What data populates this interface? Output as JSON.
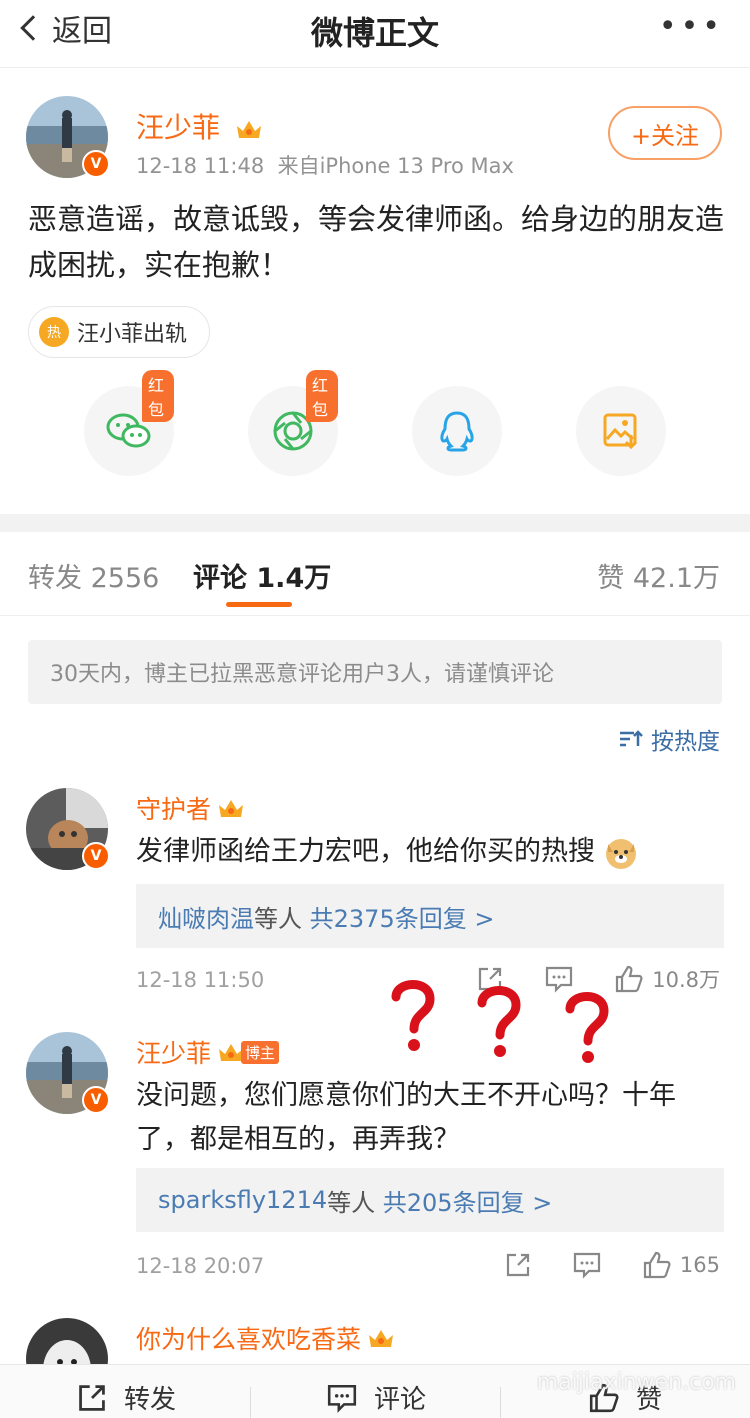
{
  "nav": {
    "back_label": "返回",
    "title": "微博正文",
    "more": "•••"
  },
  "post": {
    "author": "汪少菲",
    "verified_badge": "V",
    "time": "12-18 11:48",
    "source": "来自iPhone 13 Pro Max",
    "follow_label": "+关注",
    "text": "恶意造谣，故意诋毁，等会发律师函。给身边的朋友造成困扰，实在抱歉！",
    "topic_badge": "热",
    "topic": "汪小菲出轨",
    "share": {
      "hongbao_tag": "红包",
      "items": [
        "wechat-icon",
        "moments-icon",
        "qq-icon",
        "save-image-icon"
      ]
    }
  },
  "tabs": {
    "repost": "转发 2556",
    "comments": "评论 1.4万",
    "likes": "赞 42.1万"
  },
  "notice": "30天内，博主已拉黑恶意评论用户3人，请谨慎评论",
  "sort_label": "按热度",
  "comments": [
    {
      "name": "守护者",
      "verified_badge": "V",
      "text": "发律师函给王力宏吧，他给你买的热搜",
      "emoji": "doge-emoji",
      "reply_users": "灿啵肉温",
      "reply_mid": "等人",
      "reply_count": "共2375条回复 >",
      "time": "12-18 11:50",
      "likes": "10.8万"
    },
    {
      "name": "汪少菲",
      "verified_badge": "V",
      "host_tag": "博主",
      "text": "没问题，您们愿意你们的大王不开心吗？十年了，都是相互的，再弄我？",
      "reply_users": "sparksfly1214",
      "reply_mid": "等人",
      "reply_count": "共205条回复 >",
      "time": "12-18 20:07",
      "likes": "165"
    },
    {
      "name": "你为什么喜欢吃香菜"
    }
  ],
  "bottom_bar": {
    "repost": "转发",
    "comment": "评论",
    "like": "赞"
  },
  "watermark": "maijiaxinwen.com",
  "colors": {
    "accent_orange": "#f86914",
    "link_blue": "#4a7bb3",
    "question_mark_red": "#d9111a"
  }
}
